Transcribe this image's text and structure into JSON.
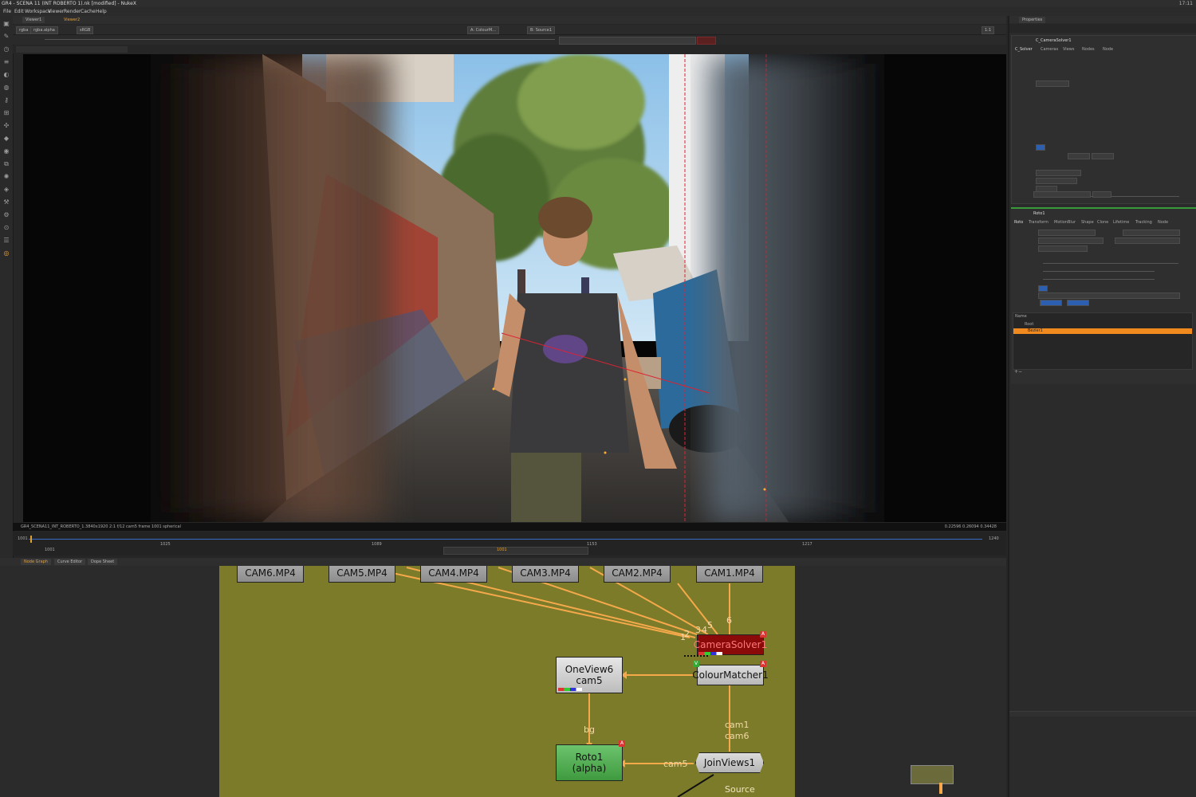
{
  "window": {
    "title": "GR4 - SCENA 11 (INT ROBERTO 1).nk [modified] - NukeX",
    "tray_text": "17:11"
  },
  "menu": {
    "items": [
      "File",
      "Edit",
      "Workspace",
      "Viewer",
      "Render",
      "Cache",
      "Help"
    ]
  },
  "viewer": {
    "tabs": [
      "Viewer1",
      "Viewer2"
    ],
    "channels": "rgba",
    "alpha": "rgba.alpha",
    "colorspace": "sRGB",
    "input_a": "A: ColourM...",
    "input_b": "B: Source1",
    "zoom": "1:1",
    "frame_range": "1001",
    "status_left": "GR4_SCENA11_INT_ROBERTO_1.3840x1920 2:1 f/12 cam5 frame 1001 spherical",
    "status_right": "0.22596 0.26094 0.34428"
  },
  "timeline": {
    "start": "1001",
    "end": "1240",
    "current": "1001",
    "ticks": [
      "1001",
      "1025",
      "1089",
      "1153",
      "1217",
      "1240"
    ]
  },
  "nodegraph": {
    "tabs": [
      "Node Graph",
      "Curve Editor",
      "Dope Sheet"
    ],
    "read_nodes": [
      "CAM6.MP4",
      "CAM5.MP4",
      "CAM4.MP4",
      "CAM3.MP4",
      "CAM2.MP4",
      "CAM1.MP4"
    ],
    "camera_solver": "CameraSolver1",
    "colour_matcher": "ColourMatcher1",
    "oneview": {
      "title": "OneView6",
      "sub": "cam5"
    },
    "roto": {
      "title": "Roto1",
      "sub": "(alpha)"
    },
    "joinviews": "JoinViews1",
    "source_label": "Source",
    "pipe_bg": "bg",
    "pipe_cam5": "cam5",
    "pipe_cam_stack": "cam1\ncam6",
    "input_numbers": [
      "1",
      "2",
      "3",
      "4",
      "5",
      "6"
    ]
  },
  "properties": {
    "tab": "Properties",
    "camera_solver_title": "C_CameraSolver1",
    "cs_tabs": [
      "C_Solver",
      "Cameras",
      "Views",
      "Nodes",
      "Node"
    ],
    "roto_title": "Roto1",
    "roto_tabs": [
      "Roto",
      "Transform",
      "MotionBlur",
      "Shape",
      "Clone",
      "Lifetime",
      "Tracking",
      "Node"
    ],
    "roto_layers": {
      "header": "Name",
      "root": "Root",
      "shape": "Bezier1"
    }
  },
  "colors": {
    "backdrop": "#7b7b2a",
    "solver_node": "#8a0a0a",
    "roto_node": "#4aa84a",
    "pipe": "#f5a94a",
    "selected_row": "#f08a1e"
  }
}
